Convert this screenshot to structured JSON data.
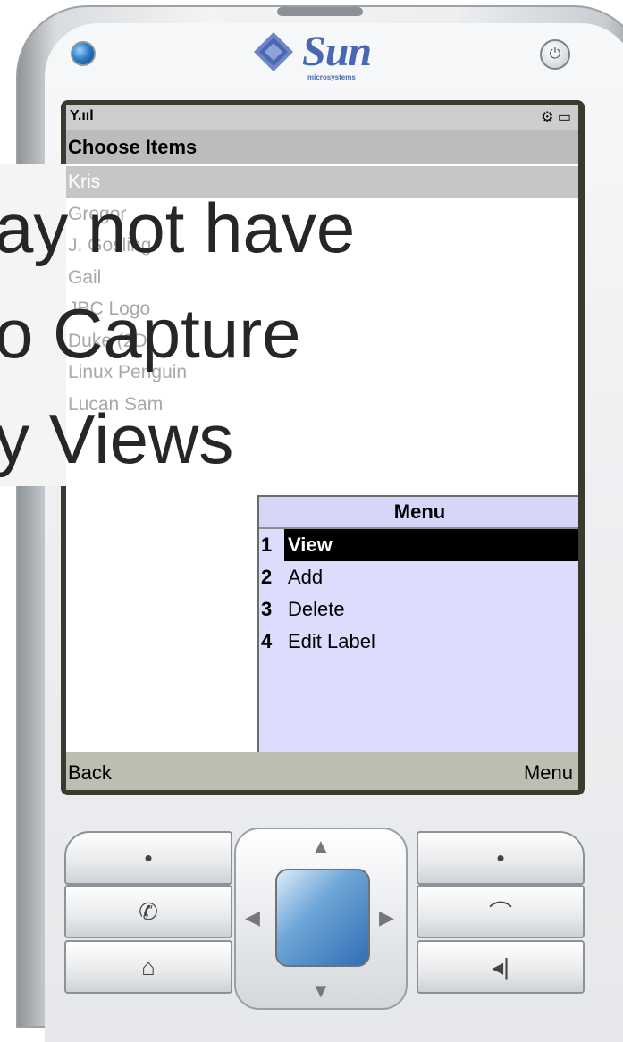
{
  "device": {
    "brand": "Sun",
    "brand_sub": "microsystems"
  },
  "status_bar": {
    "signal": "Y.ııl",
    "icons": "⚙ ▭"
  },
  "screen": {
    "title": "Choose Items",
    "list_items": [
      "Kris",
      "Gregor",
      "J. Gosling",
      "Gail",
      "JBC Logo",
      "Duke (2D)",
      "Linux Penguin",
      "Lucan Sam"
    ],
    "selected_index": 0
  },
  "overlay": {
    "lines": [
      "ay not have",
      "o Capture",
      "y Views"
    ]
  },
  "menu": {
    "title": "Menu",
    "items": [
      {
        "num": "1",
        "label": "View"
      },
      {
        "num": "2",
        "label": "Add"
      },
      {
        "num": "3",
        "label": "Delete"
      },
      {
        "num": "4",
        "label": "Edit Label"
      }
    ],
    "active_index": 0
  },
  "softkeys": {
    "left": "Back",
    "right": "Menu"
  },
  "keypad": {
    "left_keys": [
      "•",
      "📞",
      "⌂"
    ],
    "right_keys": [
      "•",
      "☎",
      "◂|"
    ],
    "dpad_icons": [
      "up-arrow",
      "down-arrow",
      "left-arrow",
      "right-arrow"
    ]
  },
  "colors": {
    "logo": "#4a67b4",
    "screen_bezel": "#3b3a2f",
    "menu_bg": "#dcdcfd",
    "softkey_bg": "#bdbdb1"
  }
}
